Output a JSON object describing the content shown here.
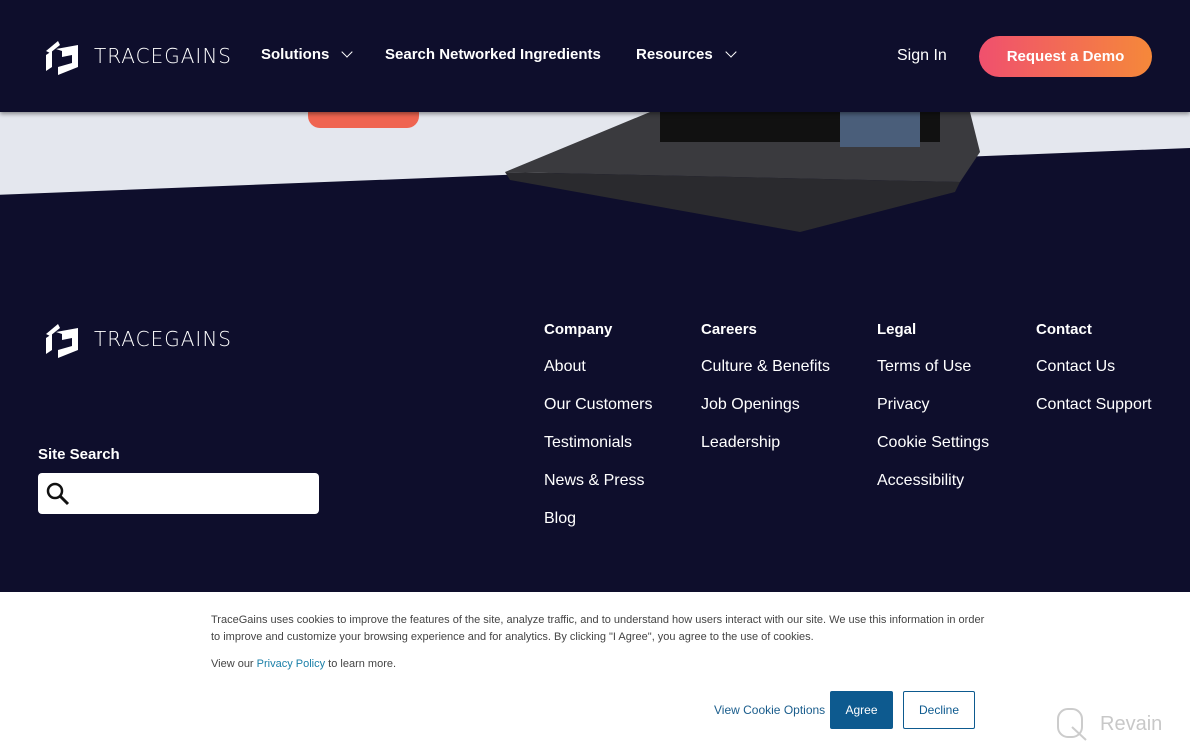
{
  "header": {
    "brand": "TRACEGAINS",
    "nav": [
      {
        "label": "Solutions"
      },
      {
        "label": "Search Networked Ingredients"
      },
      {
        "label": "Resources"
      }
    ],
    "sign_in": "Sign In",
    "demo": "Request a Demo"
  },
  "footer": {
    "brand": "TRACEGAINS",
    "site_search_label": "Site Search",
    "search_placeholder": "",
    "columns": [
      {
        "title": "Company",
        "links": [
          "About",
          "Our Customers",
          "Testimonials",
          "News & Press",
          "Blog"
        ]
      },
      {
        "title": "Careers",
        "links": [
          "Culture & Benefits",
          "Job Openings",
          "Leadership"
        ]
      },
      {
        "title": "Legal",
        "links": [
          "Terms of Use",
          "Privacy",
          "Cookie Settings",
          "Accessibility"
        ]
      },
      {
        "title": "Contact",
        "links": [
          "Contact Us",
          "Contact Support"
        ]
      }
    ]
  },
  "cookie": {
    "text": "TraceGains uses cookies to improve the features of the site, analyze traffic, and to understand how users interact with our site. We use this information in order to improve and customize your browsing experience and for analytics. By clicking \"I Agree\", you agree to the use of cookies.",
    "pp_prefix": "View our ",
    "pp_link": "Privacy Policy",
    "pp_suffix": " to learn more.",
    "options": "View Cookie Options",
    "agree": "Agree",
    "decline": "Decline"
  },
  "watermark": "Revain",
  "colors": {
    "navy": "#0e0e2c",
    "demo_gradient_start": "#f0506e",
    "demo_gradient_end": "#f5883a",
    "agree": "#0d5a8f"
  }
}
